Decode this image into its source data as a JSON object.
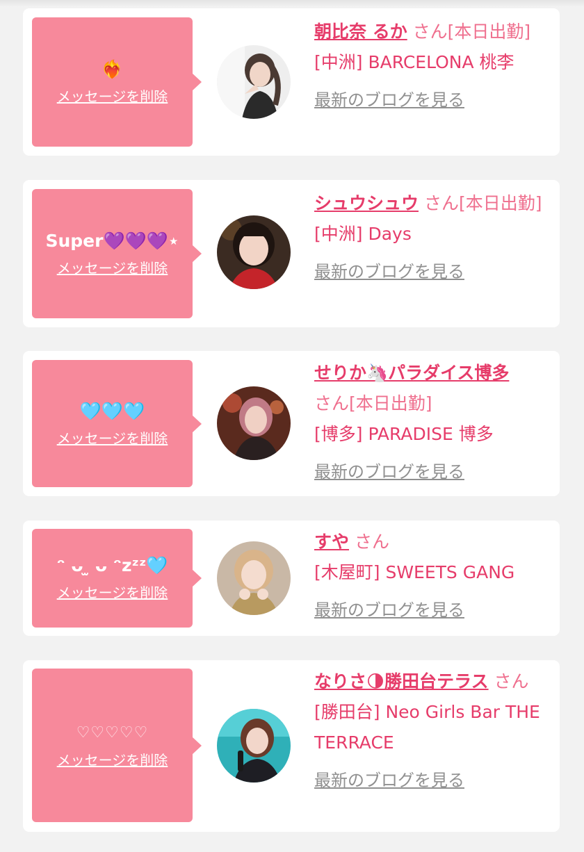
{
  "colors": {
    "background": "#f2f2f2",
    "card": "#ffffff",
    "bubble": "#f7899b",
    "accent": "#e63c6a",
    "link_gray": "#909090"
  },
  "items": [
    {
      "message": "❤️‍🔥",
      "delete_label": "メッセージを削除",
      "name": "朝比奈 るか",
      "suffix": " さん[本日出勤]",
      "shop": "[中洲] BARCELONA 桃李",
      "blog_label": "最新のブログを見る",
      "avatar_icon": "woman-portrait-avatar"
    },
    {
      "message": "Super💜💜💜⋆",
      "delete_label": "メッセージを削除",
      "name": "シュウシュウ",
      "suffix": " さん[本日出勤]",
      "shop": "[中洲] Days",
      "blog_label": "最新のブログを見る",
      "avatar_icon": "woman-portrait-avatar"
    },
    {
      "message": "🩵🩵🩵",
      "delete_label": "メッセージを削除",
      "name": "せりか🦄パラダイス博多",
      "suffix": "さん[本日出勤]",
      "shop": "[博多] PARADISE 博多",
      "blog_label": "最新のブログを見る",
      "avatar_icon": "woman-portrait-avatar"
    },
    {
      "message": "ᵔ ᴗ ̫ ᴗ ᵔzᶻᶻ🩵",
      "delete_label": "メッセージを削除",
      "name": "すや",
      "suffix": " さん",
      "shop": "[木屋町] SWEETS GANG",
      "blog_label": "最新のブログを見る",
      "avatar_icon": "woman-portrait-avatar"
    },
    {
      "message": "♡♡♡♡♡",
      "delete_label": "メッセージを削除",
      "name": "なりさ🌗勝田台テラス",
      "suffix": " さん",
      "shop": "[勝田台] Neo Girls Bar THE TERRACE",
      "blog_label": "最新のブログを見る",
      "avatar_icon": "woman-portrait-avatar"
    }
  ]
}
